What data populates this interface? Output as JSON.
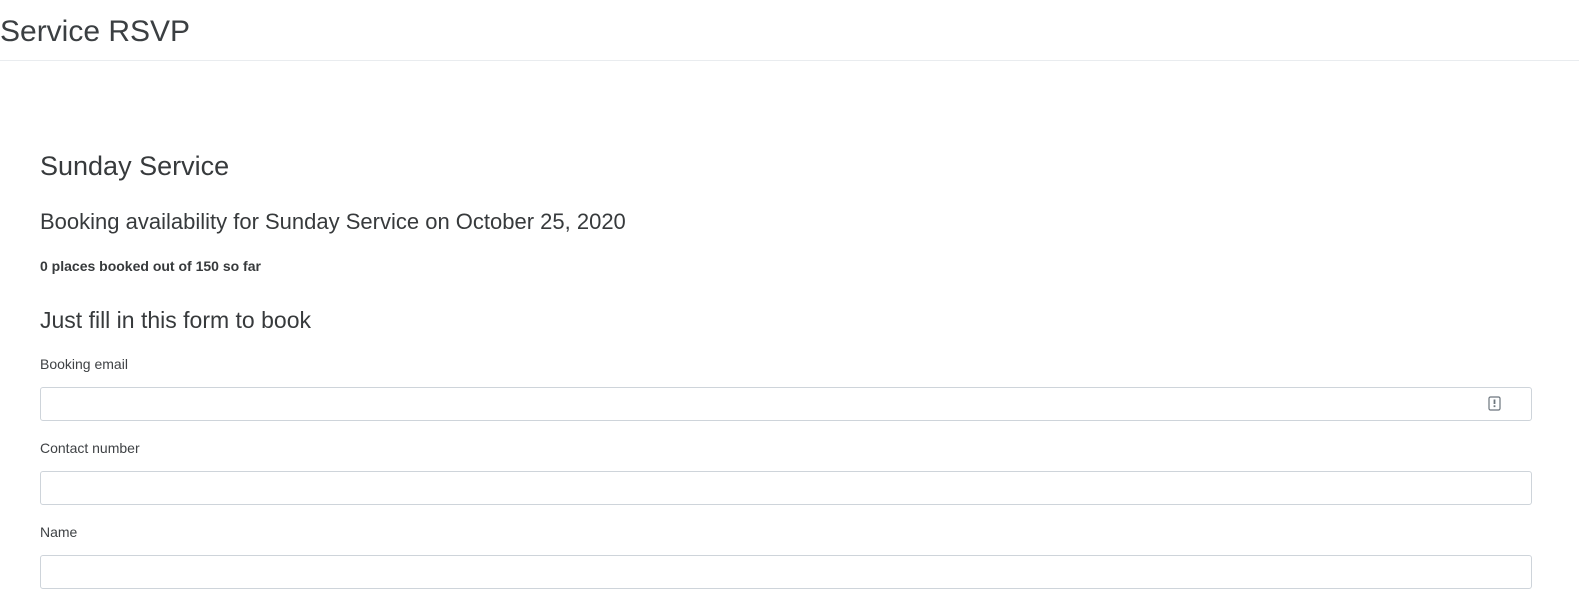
{
  "navbar": {
    "brand": "Service RSVP"
  },
  "event": {
    "title": "Sunday Service",
    "availability_heading": "Booking availability for Sunday Service on October 25, 2020",
    "booked_status": "0 places booked out of 150 so far"
  },
  "form": {
    "heading": "Just fill in this form to book",
    "fields": [
      {
        "label": "Booking email",
        "value": "",
        "icon": "autofill-contact-icon"
      },
      {
        "label": "Contact number",
        "value": ""
      },
      {
        "label": "Name",
        "value": ""
      }
    ]
  }
}
